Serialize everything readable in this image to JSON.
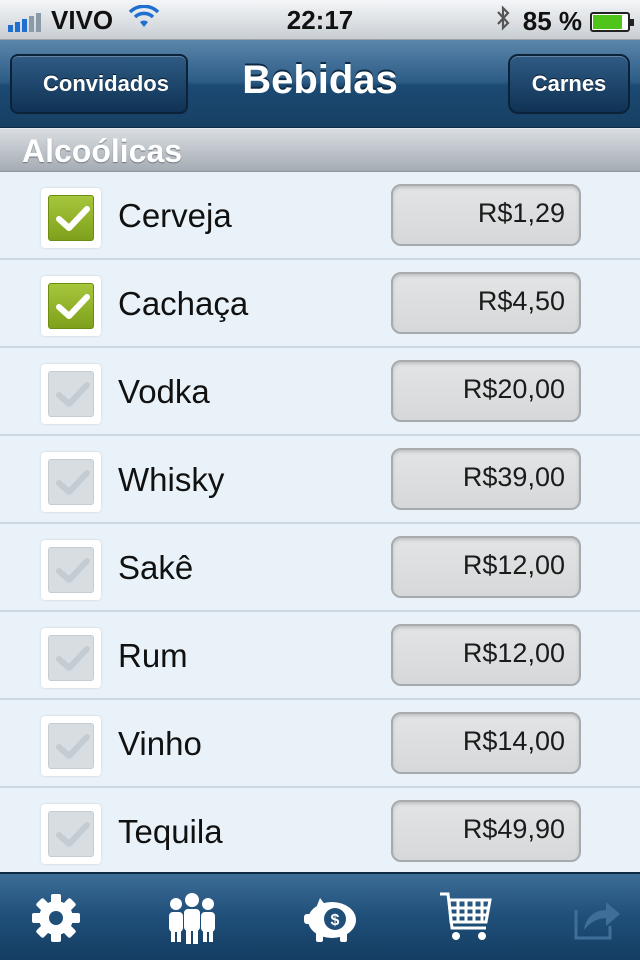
{
  "status_bar": {
    "carrier": "VIVO",
    "time": "22:17",
    "battery_text": "85 %",
    "battery_level": 0.85
  },
  "nav": {
    "title": "Bebidas",
    "back_label": "Convidados",
    "forward_label": "Carnes"
  },
  "section": {
    "title": "Alcoólicas"
  },
  "items": [
    {
      "name": "Cerveja",
      "price": "R$1,29",
      "checked": true
    },
    {
      "name": "Cachaça",
      "price": "R$4,50",
      "checked": true
    },
    {
      "name": "Vodka",
      "price": "R$20,00",
      "checked": false
    },
    {
      "name": "Whisky",
      "price": "R$39,00",
      "checked": false
    },
    {
      "name": "Sakê",
      "price": "R$12,00",
      "checked": false
    },
    {
      "name": "Rum",
      "price": "R$12,00",
      "checked": false
    },
    {
      "name": "Vinho",
      "price": "R$14,00",
      "checked": false
    },
    {
      "name": "Tequila",
      "price": "R$49,90",
      "checked": false
    }
  ],
  "tabs": [
    {
      "icon": "gear-icon"
    },
    {
      "icon": "people-icon"
    },
    {
      "icon": "piggy-bank-icon"
    },
    {
      "icon": "shopping-cart-icon"
    },
    {
      "icon": "share-icon"
    }
  ],
  "colors": {
    "accent_green": "#8db02a",
    "nav_blue": "#1c4a73",
    "wifi_blue": "#1f6fd0",
    "battery_green": "#4fc51b"
  }
}
